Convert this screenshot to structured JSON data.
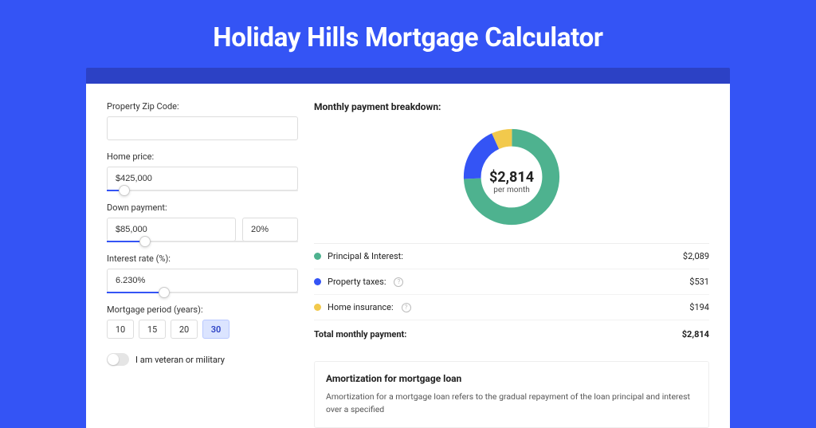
{
  "page_title": "Holiday Hills Mortgage Calculator",
  "colors": {
    "principal": "#4eb28f",
    "taxes": "#3454f5",
    "insurance": "#f2c94c"
  },
  "form": {
    "zip_label": "Property Zip Code:",
    "zip_value": "",
    "home_price_label": "Home price:",
    "home_price_value": "$425,000",
    "home_price_slider_pct": 9,
    "down_payment_label": "Down payment:",
    "down_payment_value": "$85,000",
    "down_payment_pct_value": "20%",
    "down_payment_slider_pct": 20,
    "interest_label": "Interest rate (%):",
    "interest_value": "6.230%",
    "interest_slider_pct": 30,
    "period_label": "Mortgage period (years):",
    "period_options": [
      "10",
      "15",
      "20",
      "30"
    ],
    "period_selected_index": 3,
    "veteran_label": "I am veteran or military",
    "veteran_on": false
  },
  "breakdown": {
    "title": "Monthly payment breakdown:",
    "center_value": "$2,814",
    "center_sub": "per month",
    "items": [
      {
        "label": "Principal & Interest:",
        "value": "$2,089",
        "color_key": "principal",
        "info": false
      },
      {
        "label": "Property taxes:",
        "value": "$531",
        "color_key": "taxes",
        "info": true
      },
      {
        "label": "Home insurance:",
        "value": "$194",
        "color_key": "insurance",
        "info": true
      }
    ],
    "total_label": "Total monthly payment:",
    "total_value": "$2,814"
  },
  "chart_data": {
    "type": "pie",
    "title": "Monthly payment breakdown",
    "series": [
      {
        "name": "Principal & Interest",
        "value": 2089,
        "color": "#4eb28f"
      },
      {
        "name": "Property taxes",
        "value": 531,
        "color": "#3454f5"
      },
      {
        "name": "Home insurance",
        "value": 194,
        "color": "#f2c94c"
      }
    ],
    "total": 2814,
    "center_label": "$2,814 per month"
  },
  "amortization": {
    "title": "Amortization for mortgage loan",
    "text": "Amortization for a mortgage loan refers to the gradual repayment of the loan principal and interest over a specified"
  }
}
